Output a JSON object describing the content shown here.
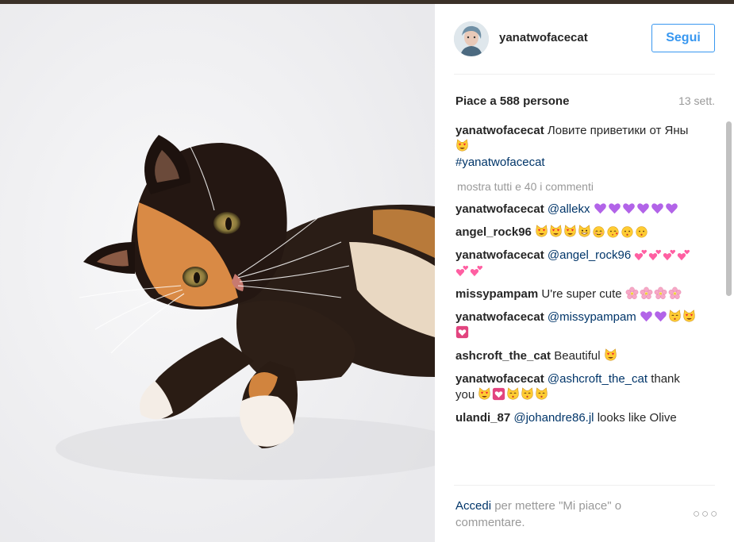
{
  "post": {
    "username": "yanatwofacecat",
    "follow_label": "Segui",
    "likes": "Piace a 588 persone",
    "time": "13 sett."
  },
  "caption": {
    "user": "yanatwofacecat",
    "text": "Ловите приветики от Яны",
    "emojis": [
      "heart-eyes-cat"
    ],
    "hashtag": "#yanatwofacecat"
  },
  "show_all": "mostra tutti e 40 i commenti",
  "comments": [
    {
      "user": "yanatwofacecat",
      "mention": "@allekx",
      "text": "",
      "emojis": [
        "purple-heart",
        "purple-heart",
        "purple-heart",
        "purple-heart",
        "purple-heart",
        "purple-heart"
      ]
    },
    {
      "user": "angel_rock96",
      "mention": "",
      "text": "",
      "emojis": [
        "heart-eyes-cat",
        "heart-eyes-cat",
        "heart-eyes-cat",
        "grinning-cat",
        "blush-face",
        "kissing-heart-face",
        "kissing-face",
        "kissing-face"
      ]
    },
    {
      "user": "yanatwofacecat",
      "mention": "@angel_rock96",
      "text": "",
      "emojis": [
        "two-hearts",
        "two-hearts",
        "two-hearts",
        "two-hearts",
        "two-hearts",
        "two-hearts"
      ]
    },
    {
      "user": "missypampam",
      "mention": "",
      "text": "U're super cute",
      "emojis": [
        "cherry-blossom",
        "cherry-blossom",
        "cherry-blossom",
        "cherry-blossom"
      ]
    },
    {
      "user": "yanatwofacecat",
      "mention": "@missypampam",
      "text": "",
      "emojis": [
        "purple-heart",
        "purple-heart",
        "kissing-cat",
        "heart-eyes-cat",
        "heart-box"
      ]
    },
    {
      "user": "ashcroft_the_cat",
      "mention": "",
      "text": "Beautiful",
      "emojis": [
        "heart-eyes-cat"
      ]
    },
    {
      "user": "yanatwofacecat",
      "mention": "@ashcroft_the_cat",
      "text": "thank you",
      "emojis": [
        "heart-eyes-cat",
        "heart-box",
        "kissing-cat",
        "kissing-cat",
        "kissing-cat"
      ]
    },
    {
      "user": "ulandi_87",
      "mention": "@johandre86.jl",
      "text": "looks like Olive",
      "emojis": []
    }
  ],
  "footer": {
    "login_label": "Accedi",
    "rest": " per mettere \"Mi piace\" o commentare.",
    "more_label": "○○○"
  },
  "colors": {
    "link_blue": "#3897f0",
    "mention_blue": "#003569",
    "muted": "#999999",
    "text": "#262626"
  }
}
